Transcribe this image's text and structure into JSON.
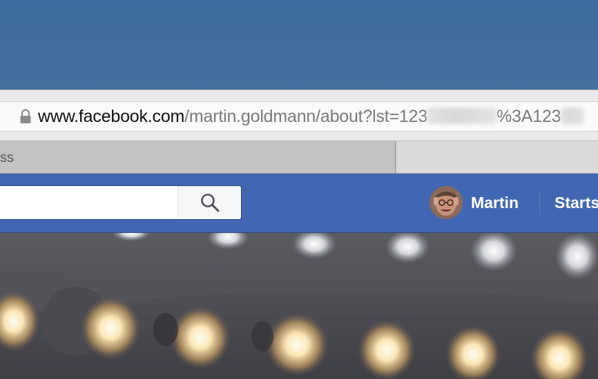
{
  "browser": {
    "url": {
      "domain": "www.facebook.com",
      "path": "/martin.goldmann/about?lst=123",
      "part2": "%3A123"
    },
    "tabs": [
      {
        "label": "ss"
      },
      {
        "label": ""
      }
    ]
  },
  "facebook": {
    "search": {
      "placeholder": ""
    },
    "user": {
      "name": "Martin"
    },
    "nav": {
      "home_label": "Starts"
    }
  },
  "colors": {
    "facebook_blue": "#4267b2",
    "top_band": "#446e9f"
  },
  "icons": [
    "lock-icon",
    "search-icon"
  ]
}
